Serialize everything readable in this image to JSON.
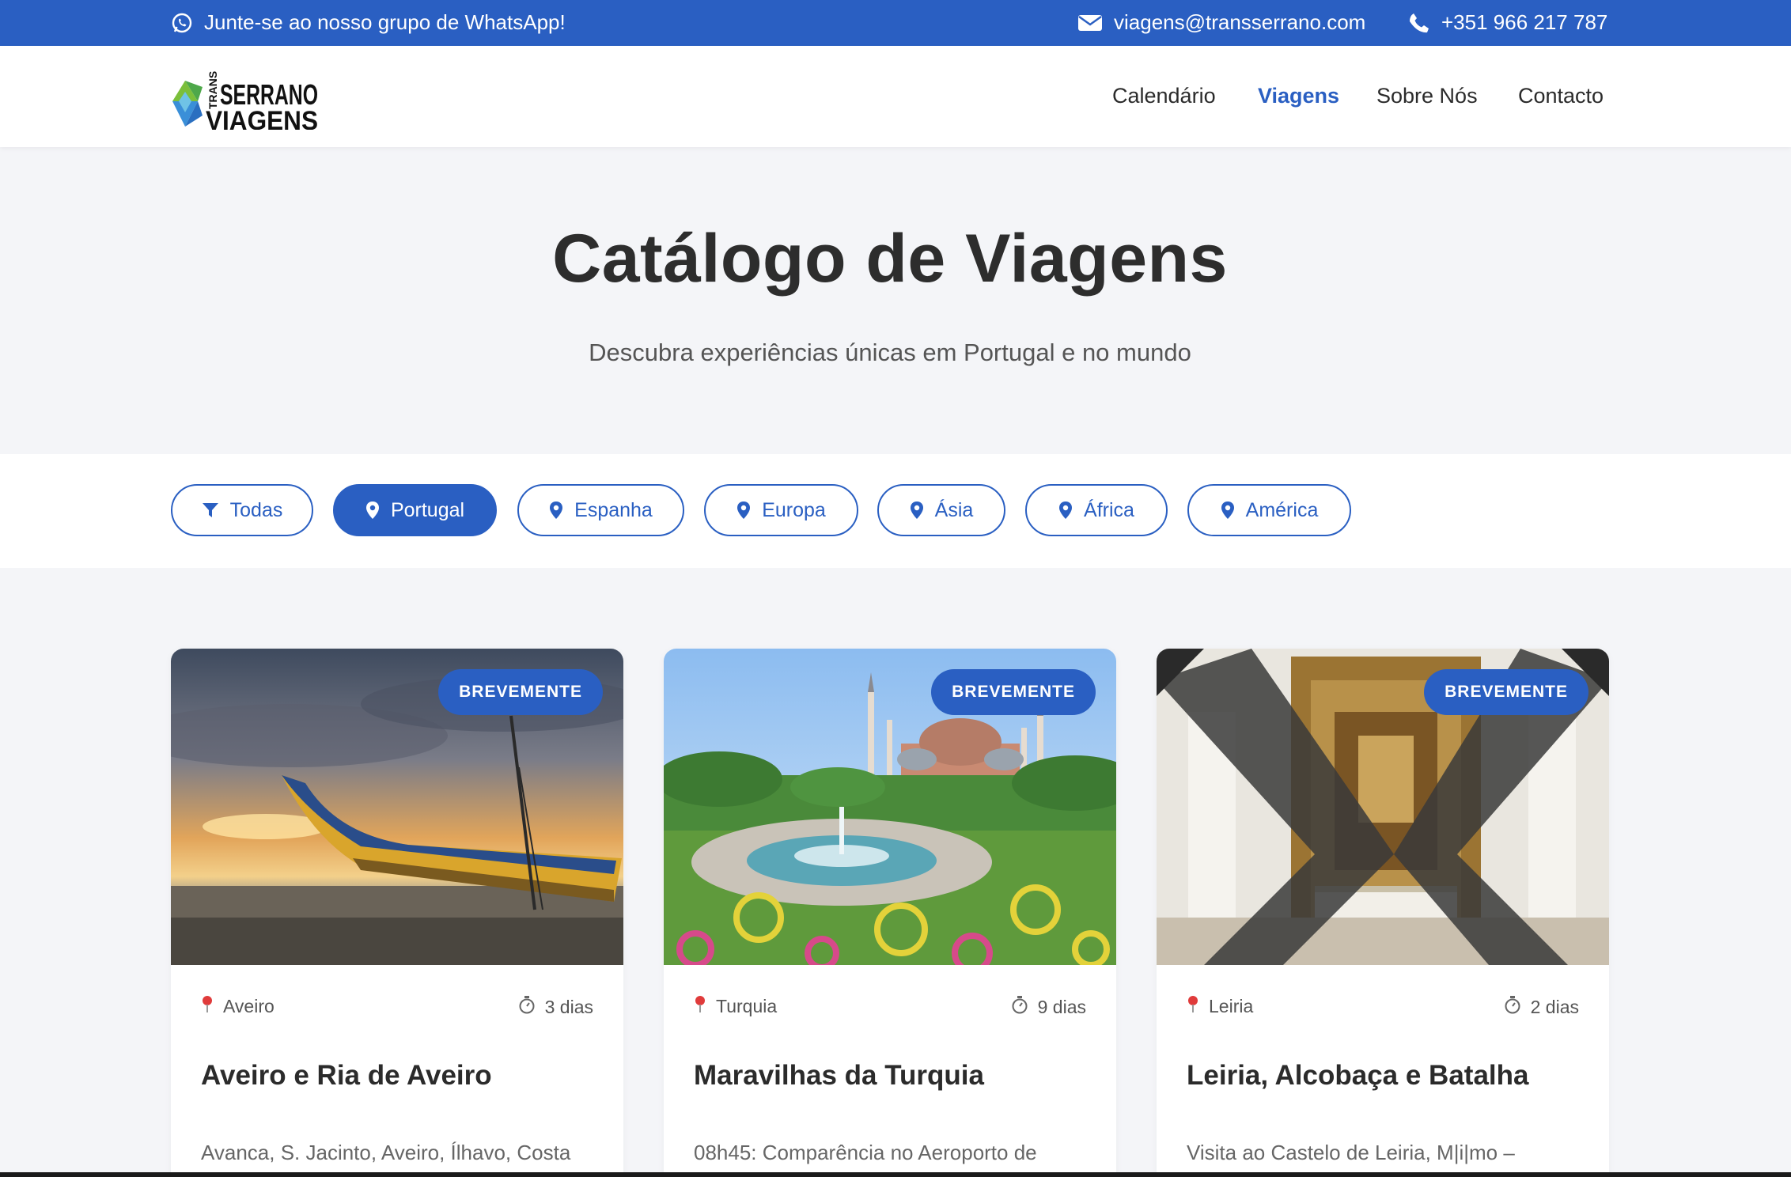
{
  "topbar": {
    "whatsapp_text": "Junte-se ao nosso grupo de WhatsApp!",
    "email": "viagens@transserrano.com",
    "phone": "+351 966 217 787",
    "icons": [
      "whatsapp-icon",
      "envelope-icon",
      "phone-icon"
    ]
  },
  "header": {
    "logo": {
      "line1_small": "TRANS",
      "line1": "SERRANO",
      "line2": "VIAGENS"
    },
    "nav": [
      {
        "label": "Calendário",
        "active": false
      },
      {
        "label": "Viagens",
        "active": true
      },
      {
        "label": "Sobre Nós",
        "active": false
      },
      {
        "label": "Contacto",
        "active": false
      }
    ]
  },
  "hero": {
    "title": "Catálogo de Viagens",
    "subtitle": "Descubra experiências únicas em Portugal e no mundo"
  },
  "filters": [
    {
      "label": "Todas",
      "icon": "filter-icon",
      "active": false
    },
    {
      "label": "Portugal",
      "icon": "map-pin-icon",
      "active": true
    },
    {
      "label": "Espanha",
      "icon": "map-pin-icon",
      "active": false
    },
    {
      "label": "Europa",
      "icon": "map-pin-icon",
      "active": false
    },
    {
      "label": "Ásia",
      "icon": "map-pin-icon",
      "active": false
    },
    {
      "label": "África",
      "icon": "map-pin-icon",
      "active": false
    },
    {
      "label": "América",
      "icon": "map-pin-icon",
      "active": false
    }
  ],
  "trips": [
    {
      "badge": "BREVEMENTE",
      "location": "Aveiro",
      "duration": "3 dias",
      "title": "Aveiro e Ria de Aveiro",
      "description": "Avanca, S. Jacinto, Aveiro, Ílhavo, Costa",
      "image": "moliceiro boat on beach at sunset"
    },
    {
      "badge": "BREVEMENTE",
      "location": "Turquia",
      "duration": "9 dias",
      "title": "Maravilhas da Turquia",
      "description": "08h45: Comparência no Aeroporto de",
      "image": "Hagia Sophia with fountain and gardens"
    },
    {
      "badge": "BREVEMENTE",
      "location": "Leiria",
      "duration": "2 dias",
      "title": "Leiria, Alcobaça e Batalha",
      "description": "Visita ao Castelo de Leiria, M|i|mo –",
      "image": "gilded church altar seen through grille"
    }
  ],
  "colors": {
    "brand": "#2a5fc2",
    "background": "#f4f5f8",
    "text": "#2b2b2b",
    "pin": "#e03b3b"
  }
}
